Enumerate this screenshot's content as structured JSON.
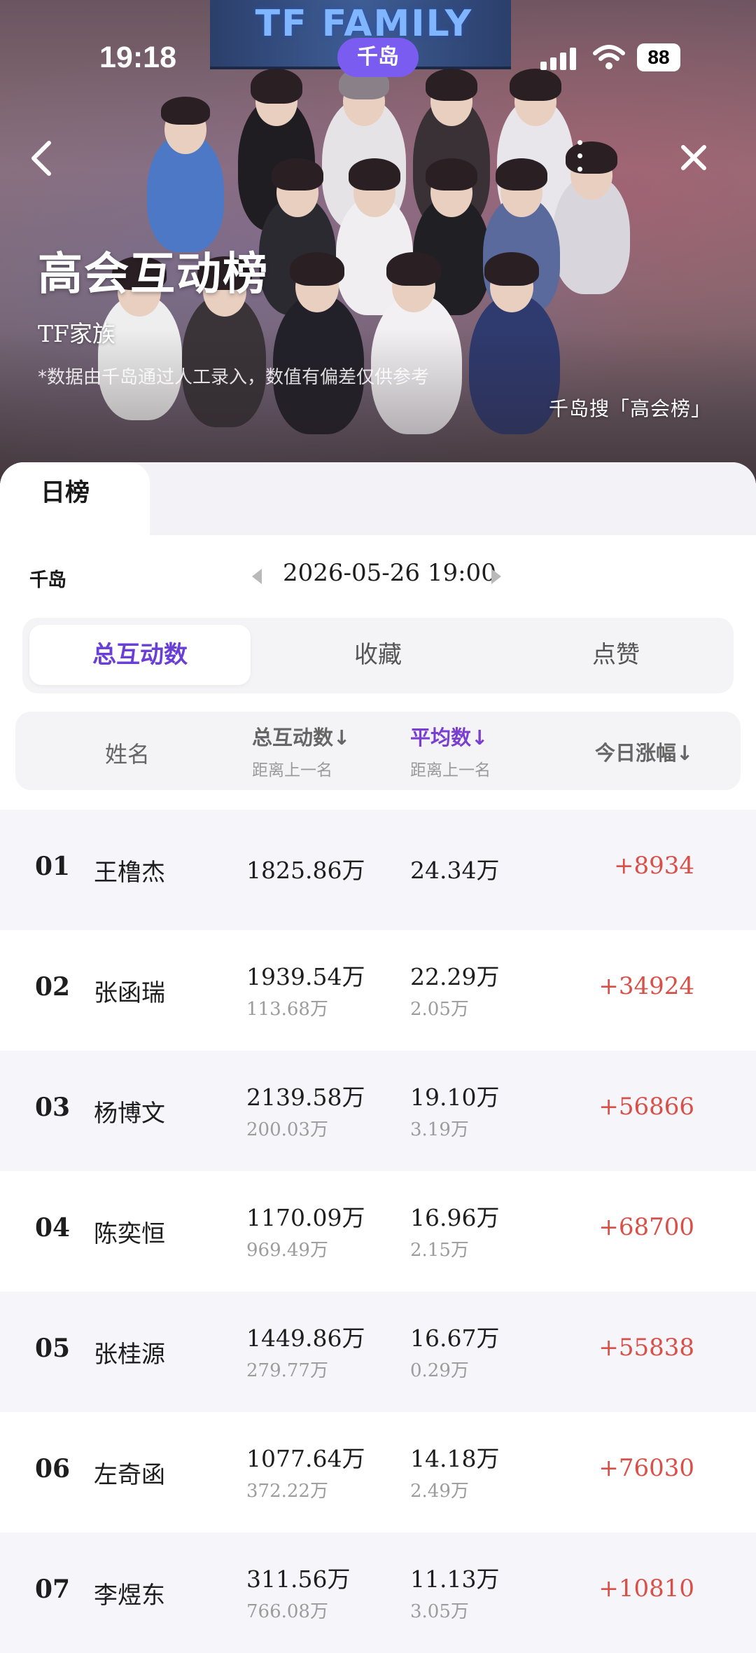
{
  "status_bar": {
    "time": "19:18",
    "battery": "88"
  },
  "hero": {
    "app_badge": "千岛",
    "banner_text": "TF FAMILY",
    "title": "高会互动榜",
    "subtitle": "TF家族",
    "note": "*数据由千岛通过人工录入，数值有偏差仅供参考",
    "search_hint": "千岛搜「高会榜」"
  },
  "tabs": {
    "daily": "日榜"
  },
  "brand": "千岛",
  "date": "2026-05-26 19:00",
  "segments": [
    {
      "label": "总互动数",
      "active": true
    },
    {
      "label": "收藏",
      "active": false
    },
    {
      "label": "点赞",
      "active": false
    }
  ],
  "table_header": {
    "name": "姓名",
    "total": "总互动数↓",
    "total_sub": "距离上一名",
    "avg": "平均数↓",
    "avg_sub": "距离上一名",
    "today": "今日涨幅↓"
  },
  "colors": {
    "accent": "#6a3fd6",
    "positive": "#d95048",
    "row_alt": "#f6f5fa"
  },
  "rows": [
    {
      "rank": "01",
      "name": "王橹杰",
      "total": "1825.86万",
      "total_gap": "",
      "avg": "24.34万",
      "avg_gap": "",
      "delta": "+8934"
    },
    {
      "rank": "02",
      "name": "张函瑞",
      "total": "1939.54万",
      "total_gap": "113.68万",
      "avg": "22.29万",
      "avg_gap": "2.05万",
      "delta": "+34924"
    },
    {
      "rank": "03",
      "name": "杨博文",
      "total": "2139.58万",
      "total_gap": "200.03万",
      "avg": "19.10万",
      "avg_gap": "3.19万",
      "delta": "+56866"
    },
    {
      "rank": "04",
      "name": "陈奕恒",
      "total": "1170.09万",
      "total_gap": "969.49万",
      "avg": "16.96万",
      "avg_gap": "2.15万",
      "delta": "+68700"
    },
    {
      "rank": "05",
      "name": "张桂源",
      "total": "1449.86万",
      "total_gap": "279.77万",
      "avg": "16.67万",
      "avg_gap": "0.29万",
      "delta": "+55838"
    },
    {
      "rank": "06",
      "name": "左奇函",
      "total": "1077.64万",
      "total_gap": "372.22万",
      "avg": "14.18万",
      "avg_gap": "2.49万",
      "delta": "+76030"
    },
    {
      "rank": "07",
      "name": "李煜东",
      "total": "311.56万",
      "total_gap": "766.08万",
      "avg": "11.13万",
      "avg_gap": "3.05万",
      "delta": "+10810"
    }
  ]
}
